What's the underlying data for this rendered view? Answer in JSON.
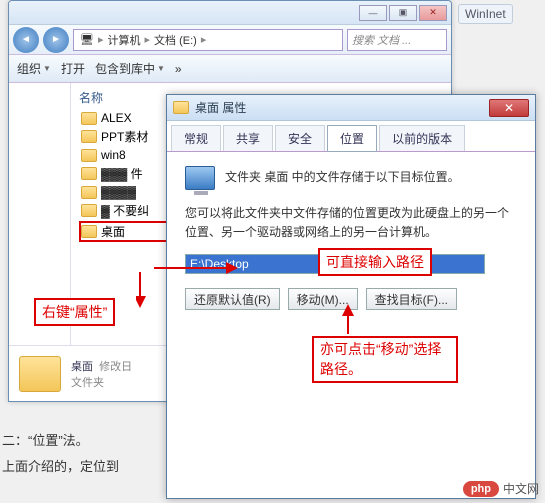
{
  "bg_tab": "WinInet",
  "explorer": {
    "nav_back_glyph": "◄",
    "nav_fwd_glyph": "►",
    "crumb_computer_icon": "🖥",
    "crumb1": "计算机",
    "crumb2": "文档 (E:)",
    "search_placeholder": "搜索 文档 ...",
    "toolbar": {
      "organize": "组织",
      "open": "打开",
      "include": "包含到库中",
      "dropdown_glyph": "▼",
      "chevron": "»"
    },
    "col_name": "名称",
    "files": [
      {
        "label": "ALEX"
      },
      {
        "label": "PPT素材"
      },
      {
        "label": "win8"
      },
      {
        "label": "▓▓▓ 件"
      },
      {
        "label": "▓▓▓▓"
      },
      {
        "label": "▓ 不要纠"
      },
      {
        "label": "桌面"
      }
    ],
    "detail": {
      "name": "桌面",
      "date_label": "修改日",
      "type": "文件夹"
    }
  },
  "props": {
    "title": "桌面 属性",
    "tabs": [
      "常规",
      "共享",
      "安全",
      "位置",
      "以前的版本"
    ],
    "active_tab": 3,
    "line1": "文件夹 桌面 中的文件存储于以下目标位置。",
    "line2": "您可以将此文件夹中文件存储的位置更改为此硬盘上的另一个位置、另一个驱动器或网络上的另一台计算机。",
    "path_value": "E:\\Desktop",
    "buttons": {
      "restore": "还原默认值(R)",
      "move": "移动(M)...",
      "find": "查找目标(F)..."
    }
  },
  "annot": {
    "a1": "右键“属性”",
    "a2": "可直接输入路径",
    "a3": "亦可点击“移动”选择路径。"
  },
  "bottom": {
    "t1": "二：“位置”法。",
    "t2": "上面介绍的，定位到"
  },
  "watermark": {
    "badge": "php",
    "text": "中文网"
  }
}
